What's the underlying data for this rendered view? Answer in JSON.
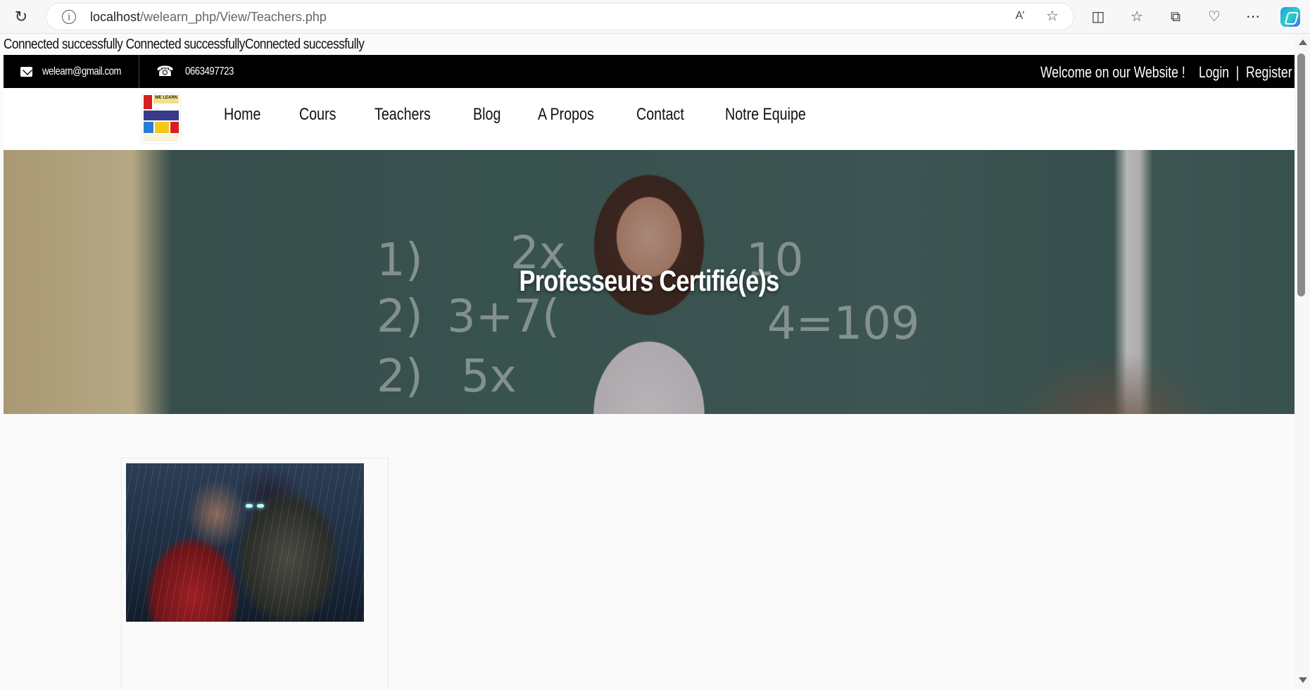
{
  "browser": {
    "url_host": "localhost",
    "url_path": "/welearn_php/View/Teachers.php"
  },
  "page": {
    "connection_message": "Connected successfully Connected successfullyConnected successfully",
    "topbar": {
      "email": "welearn@gmail.com",
      "phone": "0663497723",
      "welcome": "Welcome on our Website !",
      "login": "Login",
      "separator": "|",
      "register": "Register"
    },
    "nav": {
      "items": [
        "Home",
        "Cours",
        "Teachers",
        "Blog",
        "A Propos",
        "Contact",
        "Notre Equipe"
      ]
    },
    "hero": {
      "title": "Professeurs Certifié(e)s",
      "chalk": [
        "1)",
        "2)",
        "3+7(",
        "2)",
        "5x",
        "2x",
        "10",
        "4=109"
      ]
    },
    "logo": {
      "text": "WE LEARN"
    }
  },
  "colors": {
    "topbar_bg": "#000000",
    "nav_bg": "#ffffff",
    "page_bg": "#fafafa"
  }
}
